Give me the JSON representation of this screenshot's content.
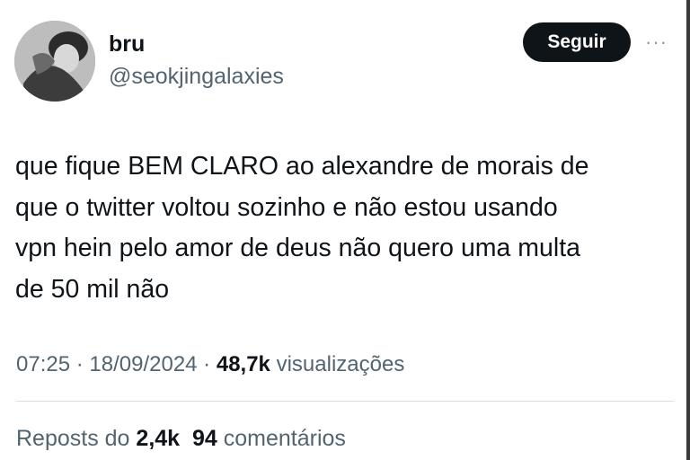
{
  "author": {
    "name": "bru",
    "handle": "@seokjingalaxies"
  },
  "actions": {
    "follow_label": "Seguir",
    "more_label": "···"
  },
  "tweet": {
    "text": "que fique BEM CLARO ao alexandre de morais de\nque o twitter voltou sozinho e não estou usando\nvpn hein pelo amor de deus não quero uma multa\nde 50 mil não"
  },
  "meta": {
    "time": "07:25",
    "separator": " · ",
    "date": "18/09/2024",
    "views_count": "48,7k",
    "views_label": "visualizações"
  },
  "stats": {
    "reposts_label": "Reposts do",
    "reposts_count": "2,4k",
    "comments_count": "94",
    "comments_label": "comentários"
  }
}
